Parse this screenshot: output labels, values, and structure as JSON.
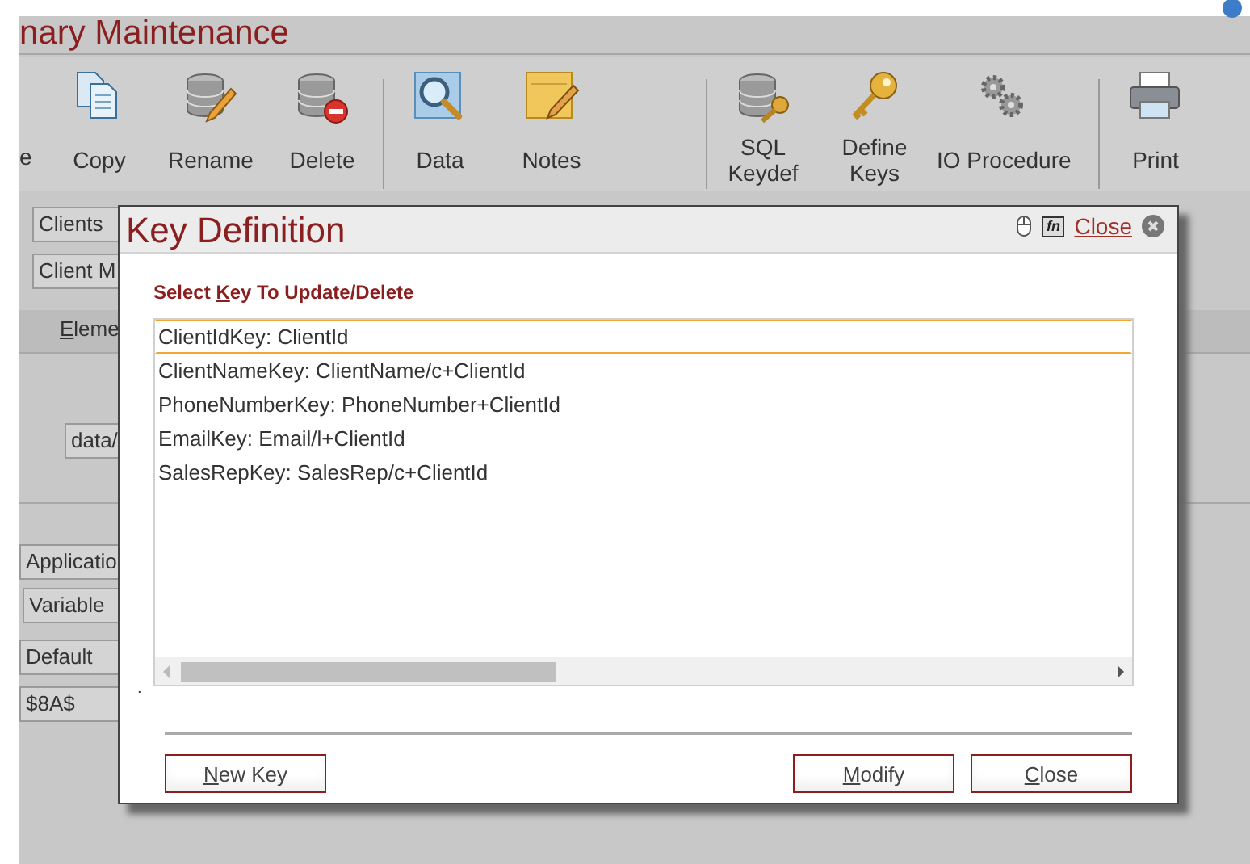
{
  "background": {
    "title": "nary Maintenance",
    "toolbar_groups": [
      [
        {
          "label": "e"
        },
        {
          "label": "Copy"
        },
        {
          "label": "Rename"
        },
        {
          "label": "Delete"
        }
      ],
      [
        {
          "label": "Data"
        },
        {
          "label": "Notes"
        }
      ],
      [
        {
          "label": "SQL\nKeydef"
        },
        {
          "label": "Define\nKeys"
        },
        {
          "label": "IO Procedure"
        }
      ],
      [
        {
          "label": "Print"
        }
      ]
    ],
    "upper_fields": [
      "Clients",
      "Client M"
    ],
    "tab": {
      "key": "E",
      "after": "leme"
    },
    "path_field": "data/",
    "lower_fields": [
      "Applicatio",
      "Variable",
      "Default",
      "$8A$"
    ]
  },
  "dialog": {
    "title": "Key Definition",
    "fn_label": "fn",
    "close_link": "Close",
    "prompt": {
      "before": "Select ",
      "key": "K",
      "after": "ey To Update/Delete"
    },
    "keys": [
      {
        "text": "ClientIdKey: ClientId",
        "selected": true
      },
      {
        "text": "ClientNameKey: ClientName/c+ClientId",
        "selected": false
      },
      {
        "text": "PhoneNumberKey: PhoneNumber+ClientId",
        "selected": false
      },
      {
        "text": "EmailKey: Email/l+ClientId",
        "selected": false
      },
      {
        "text": "SalesRepKey: SalesRep/c+ClientId",
        "selected": false
      }
    ],
    "status_text": ".",
    "buttons_left": [
      {
        "key": "N",
        "after": "ew Key"
      }
    ],
    "buttons_right": [
      {
        "key": "M",
        "after": "odify"
      },
      {
        "key": "C",
        "after": "lose"
      }
    ]
  }
}
